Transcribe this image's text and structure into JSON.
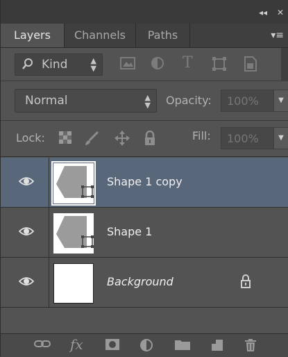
{
  "window": {
    "collapse_glyph": "◂◂",
    "close_glyph": "✕"
  },
  "tabs": [
    {
      "label": "Layers",
      "active": true
    },
    {
      "label": "Channels",
      "active": false
    },
    {
      "label": "Paths",
      "active": false
    }
  ],
  "panel_menu_glyph": "▾≡",
  "filter": {
    "kind_label": "Kind",
    "icons": [
      "pixel-filter-icon",
      "adjustment-filter-icon",
      "type-filter-icon",
      "shape-filter-icon",
      "smart-object-filter-icon"
    ],
    "type_glyph": "T"
  },
  "blend": {
    "mode": "Normal",
    "opacity_label": "Opacity:",
    "opacity_value": "100%"
  },
  "lock": {
    "label": "Lock:",
    "fill_label": "Fill:",
    "fill_value": "100%"
  },
  "layers": [
    {
      "name": "Shape 1 copy",
      "selected": true,
      "visible": true,
      "locked": false,
      "type": "shape"
    },
    {
      "name": "Shape 1",
      "selected": false,
      "visible": true,
      "locked": false,
      "type": "shape"
    },
    {
      "name": "Background",
      "selected": false,
      "visible": true,
      "locked": true,
      "type": "background"
    }
  ],
  "toolbar": {
    "fx_label": "fx",
    "icons": [
      "link-layers-icon",
      "layer-style-icon",
      "add-mask-icon",
      "new-adjustment-icon",
      "new-group-icon",
      "new-layer-icon",
      "delete-layer-icon"
    ]
  },
  "colors": {
    "panel_bg": "#535353",
    "selected_row": "#58677a",
    "tab_bar": "#3f3f3f"
  }
}
